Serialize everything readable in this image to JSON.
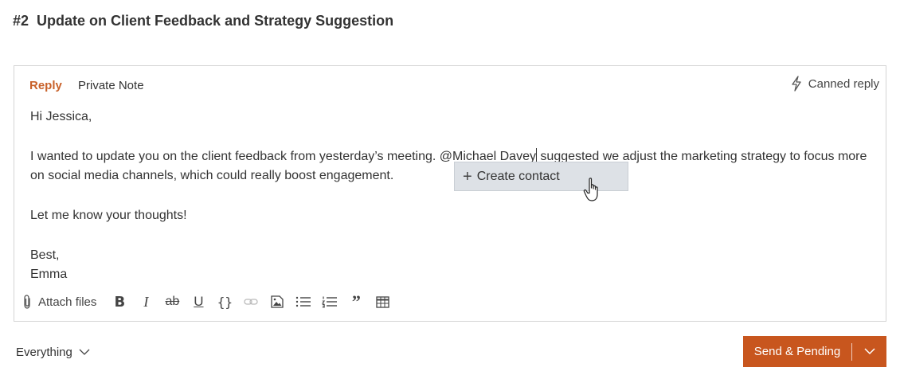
{
  "ticket": {
    "number": "#2",
    "title": "Update on Client Feedback and Strategy Suggestion"
  },
  "editor": {
    "tabs": [
      {
        "label": "Reply",
        "active": true
      },
      {
        "label": "Private Note",
        "active": false
      }
    ],
    "canned_reply_label": "Canned reply",
    "body": {
      "greeting": "Hi Jessica,",
      "para1_before": "I wanted to update you on the client feedback from yesterday’s meeting. ",
      "mention": "@Michael Davey",
      "para1_after": " suggested we adjust the marketing strategy to focus more on social media channels, which could really boost engagement.",
      "para2": "Let me know your thoughts!",
      "signoff": "Best,",
      "signature": "Emma"
    },
    "mention_popup": {
      "label": "Create contact",
      "icon": "plus-icon"
    },
    "toolbar": {
      "attach_label": "Attach files",
      "bold": "B",
      "italic": "I",
      "strike": "ab",
      "underline": "U",
      "code": "{}",
      "quote": "”"
    }
  },
  "footer": {
    "filter_label": "Everything",
    "send_label": "Send & Pending"
  },
  "colors": {
    "accent": "#c8561e",
    "reply_tab": "#c8612a",
    "popup_bg": "#dde1e6",
    "border": "#d4d4d4"
  }
}
